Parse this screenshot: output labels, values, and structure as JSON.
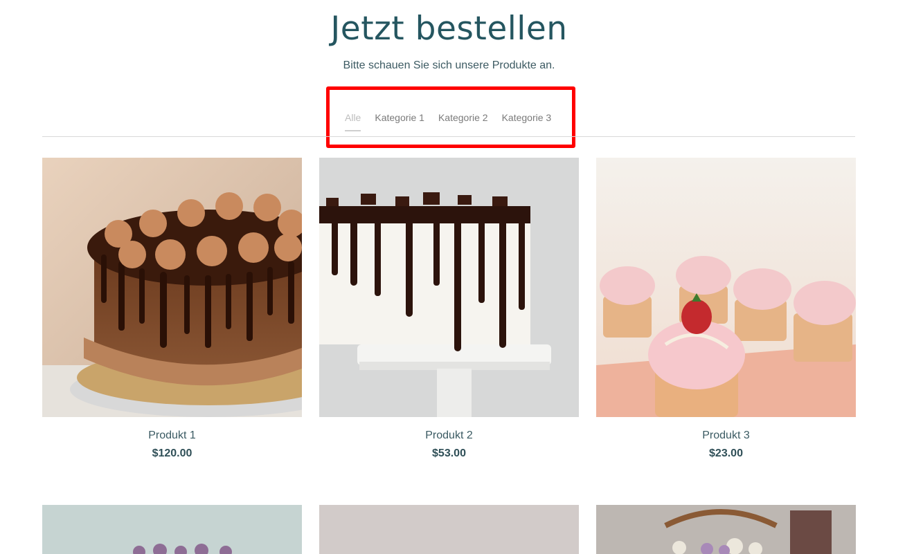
{
  "header": {
    "title": "Jetzt bestellen",
    "subtitle": "Bitte schauen Sie sich unsere Produkte an."
  },
  "tabs": [
    {
      "label": "Alle",
      "active": true
    },
    {
      "label": "Kategorie 1",
      "active": false
    },
    {
      "label": "Kategorie 2",
      "active": false
    },
    {
      "label": "Kategorie 3",
      "active": false
    }
  ],
  "products": [
    {
      "name": "Produkt 1",
      "price": "$120.00",
      "image": "chocolate-drip-cake"
    },
    {
      "name": "Produkt 2",
      "price": "$53.00",
      "image": "white-cake-chocolate-drip"
    },
    {
      "name": "Produkt 3",
      "price": "$23.00",
      "image": "strawberry-cupcakes"
    }
  ],
  "row2_images": [
    "floral-cake",
    "grey-backdrop-cake",
    "flower-tray"
  ],
  "colors": {
    "accent": "#255660",
    "highlight": "#ff0000"
  }
}
